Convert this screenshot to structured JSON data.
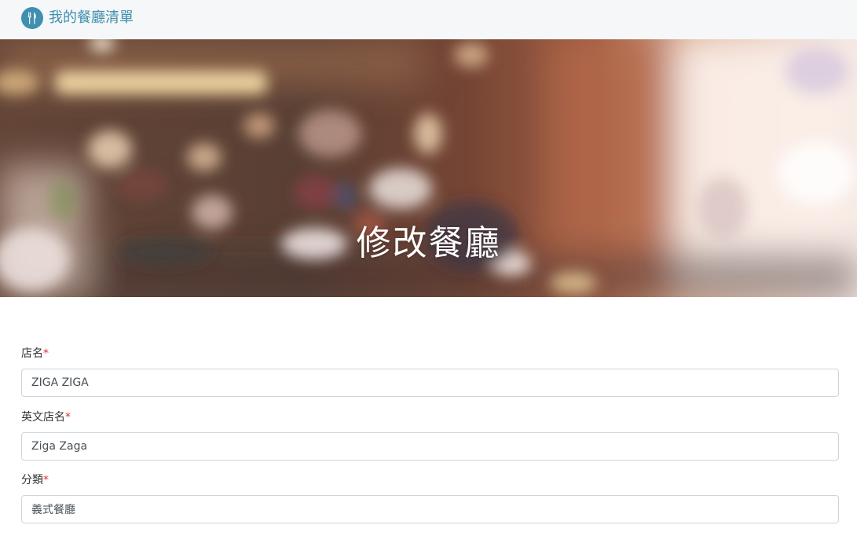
{
  "navbar": {
    "brand_icon": "fork-knife-icon",
    "brand_text": "我的餐廳清單",
    "brand_color": "#3f8fae"
  },
  "hero": {
    "title": "修改餐廳"
  },
  "form": {
    "name": {
      "label": "店名",
      "required_mark": "*",
      "value": "ZIGA ZIGA"
    },
    "name_en": {
      "label": "英文店名",
      "required_mark": "*",
      "value": "Ziga Zaga"
    },
    "category": {
      "label": "分類",
      "required_mark": "*",
      "value": "義式餐廳"
    }
  }
}
